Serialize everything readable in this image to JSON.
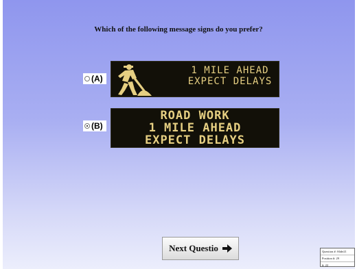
{
  "question": "Which of the following message signs do you prefer?",
  "options": [
    {
      "label": "(A)",
      "selected": false,
      "sign": {
        "lines": [
          "1 MILE AHEAD",
          "EXPECT DELAYS"
        ],
        "icon": "road-worker-icon",
        "text_color": "#e6cf82"
      }
    },
    {
      "label": "(B)",
      "selected": true,
      "sign": {
        "lines": [
          "ROAD WORK",
          "1 MILE AHEAD",
          "EXPECT DELAYS"
        ],
        "text_color": "#e6cf82"
      }
    }
  ],
  "next_button": {
    "label": "Next Questio",
    "icon": "arrow-right-icon"
  },
  "info_box": {
    "question_no": "Question #: Slide21",
    "position_no": "Position #: 29",
    "id_no": "#: 22"
  },
  "colors": {
    "background_top": "#8f96ee",
    "background_bottom": "#eceefc",
    "sign_bg": "#121008"
  }
}
